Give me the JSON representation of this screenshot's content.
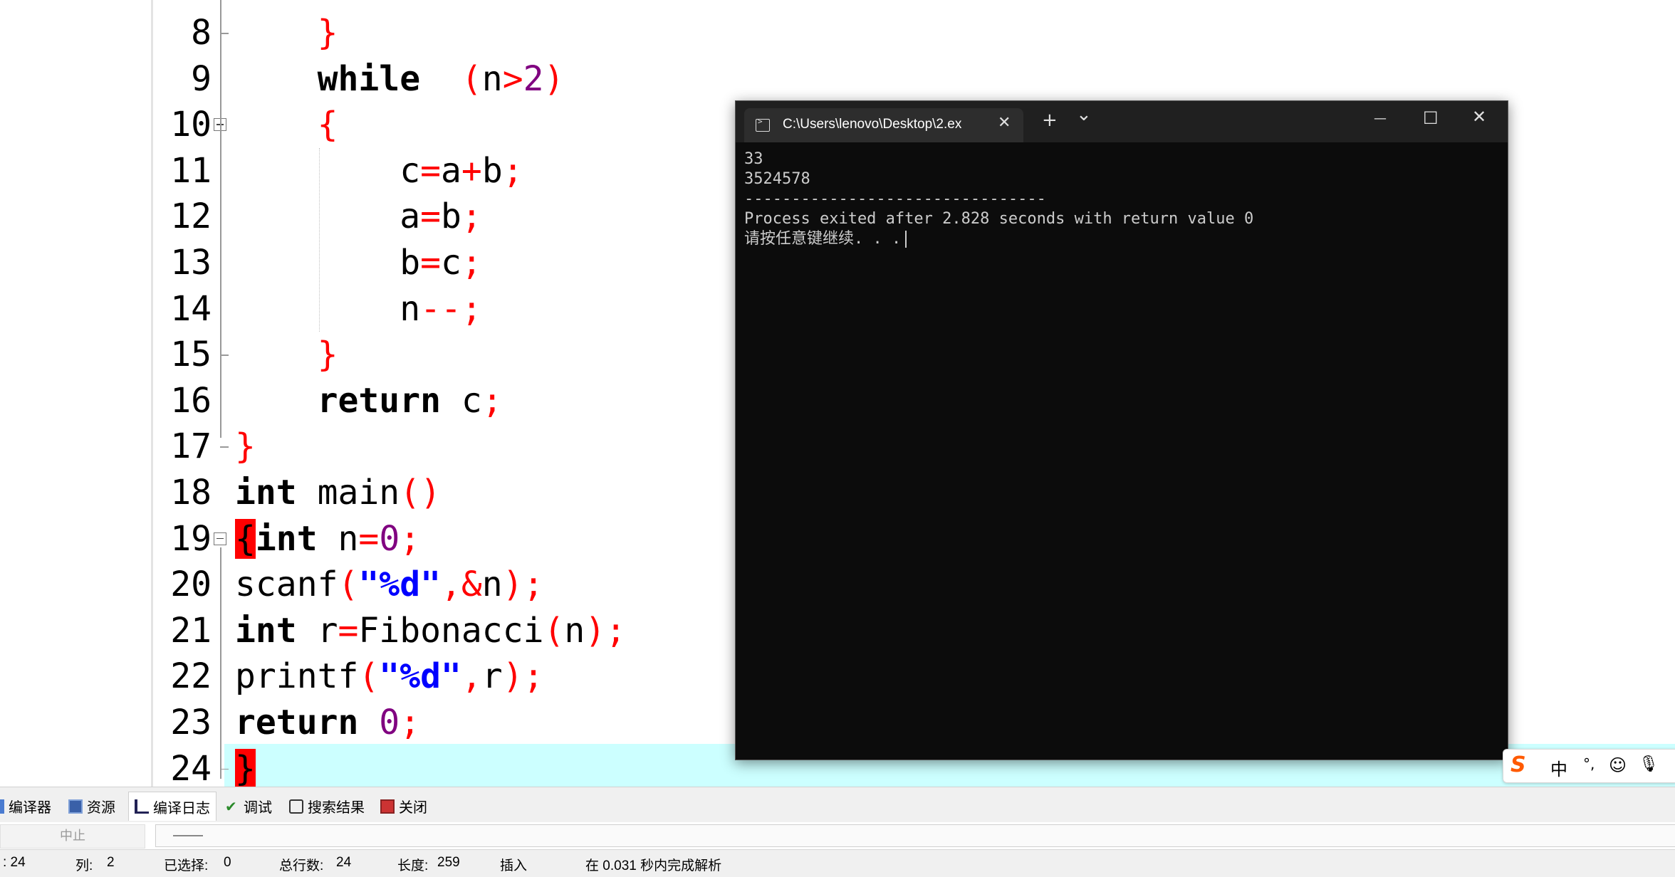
{
  "editor": {
    "lines": [
      {
        "n": "8",
        "code": [
          [
            "op",
            "    }"
          ]
        ]
      },
      {
        "n": "9",
        "code": [
          [
            "kw",
            "    while"
          ],
          [
            "",
            "  "
          ],
          [
            "op",
            "("
          ],
          [
            "",
            "n"
          ],
          [
            "op",
            ">"
          ],
          [
            "num",
            "2"
          ],
          [
            "op",
            ")"
          ]
        ]
      },
      {
        "n": "10",
        "code": [
          [
            "op",
            "    {"
          ]
        ]
      },
      {
        "n": "11",
        "code": [
          [
            "",
            "        c"
          ],
          [
            "op",
            "="
          ],
          [
            "",
            "a"
          ],
          [
            "op",
            "+"
          ],
          [
            "",
            "b"
          ],
          [
            "op",
            ";"
          ]
        ]
      },
      {
        "n": "12",
        "code": [
          [
            "",
            "        a"
          ],
          [
            "op",
            "="
          ],
          [
            "",
            "b"
          ],
          [
            "op",
            ";"
          ]
        ]
      },
      {
        "n": "13",
        "code": [
          [
            "",
            "        b"
          ],
          [
            "op",
            "="
          ],
          [
            "",
            "c"
          ],
          [
            "op",
            ";"
          ]
        ]
      },
      {
        "n": "14",
        "code": [
          [
            "",
            "        n"
          ],
          [
            "op",
            "--;"
          ]
        ]
      },
      {
        "n": "15",
        "code": [
          [
            "op",
            "    }"
          ]
        ]
      },
      {
        "n": "16",
        "code": [
          [
            "kw",
            "    return"
          ],
          [
            "",
            " c"
          ],
          [
            "op",
            ";"
          ]
        ]
      },
      {
        "n": "17",
        "code": [
          [
            "op",
            "}"
          ]
        ]
      },
      {
        "n": "18",
        "code": [
          [
            "kw",
            "int"
          ],
          [
            "",
            " main"
          ],
          [
            "op",
            "()"
          ]
        ]
      },
      {
        "n": "19",
        "code": [
          [
            "hl",
            "{"
          ],
          [
            "kw",
            "int"
          ],
          [
            "",
            " n"
          ],
          [
            "op",
            "="
          ],
          [
            "num",
            "0"
          ],
          [
            "op",
            ";"
          ]
        ]
      },
      {
        "n": "20",
        "code": [
          [
            "",
            "scanf"
          ],
          [
            "op",
            "("
          ],
          [
            "str",
            "\"%d\""
          ],
          [
            "op",
            ",&"
          ],
          [
            "",
            "n"
          ],
          [
            "op",
            ");"
          ]
        ]
      },
      {
        "n": "21",
        "code": [
          [
            "kw",
            "int"
          ],
          [
            "",
            " r"
          ],
          [
            "op",
            "="
          ],
          [
            "",
            "Fibonacci"
          ],
          [
            "op",
            "("
          ],
          [
            "",
            "n"
          ],
          [
            "op",
            ");"
          ]
        ]
      },
      {
        "n": "22",
        "code": [
          [
            "",
            "printf"
          ],
          [
            "op",
            "("
          ],
          [
            "str",
            "\"%d\""
          ],
          [
            "op",
            ","
          ],
          [
            "",
            "r"
          ],
          [
            "op",
            ");"
          ]
        ]
      },
      {
        "n": "23",
        "code": [
          [
            "kw",
            "return"
          ],
          [
            "",
            " "
          ],
          [
            "num",
            "0"
          ],
          [
            "op",
            ";"
          ]
        ]
      },
      {
        "n": "24",
        "code": [
          [
            "hl",
            "}"
          ]
        ]
      }
    ]
  },
  "console": {
    "title": "C:\\Users\\lenovo\\Desktop\\2.ex",
    "close_tab": "✕",
    "new_tab": "+",
    "dropdown": "⌄",
    "minimize": "—",
    "maximize": "☐",
    "close": "✕",
    "output": [
      "33",
      "3524578",
      "--------------------------------",
      "Process exited after 2.828 seconds with return value 0",
      "请按任意键继续. . ."
    ]
  },
  "ime": {
    "zh": "中",
    "punct": "°,",
    "emoji": "☺",
    "mic": "🎙"
  },
  "bottom_tabs": [
    {
      "label": "编译器",
      "icon": "compiler-icon"
    },
    {
      "label": "资源",
      "icon": "resources-icon"
    },
    {
      "label": "编译日志",
      "icon": "compile-log-icon"
    },
    {
      "label": "调试",
      "icon": "debug-icon"
    },
    {
      "label": "搜索结果",
      "icon": "search-results-icon"
    },
    {
      "label": "关闭",
      "icon": "close-panel-icon"
    }
  ],
  "stop_label": "中止",
  "status": {
    "line": ": 24",
    "col_label": "列:",
    "col_value": "2",
    "sel_label": "已选择:",
    "sel_value": "0",
    "total_label": "总行数:",
    "total_value": "24",
    "len_label": "长度:",
    "len_value": "259",
    "mode": "插入",
    "parse": "在 0.031 秒内完成解析"
  },
  "colors": {
    "operator": "#ff0000",
    "number": "#800080",
    "string": "#0000ff",
    "current_line": "#ccffff",
    "console_bg": "#0c0c0c"
  }
}
